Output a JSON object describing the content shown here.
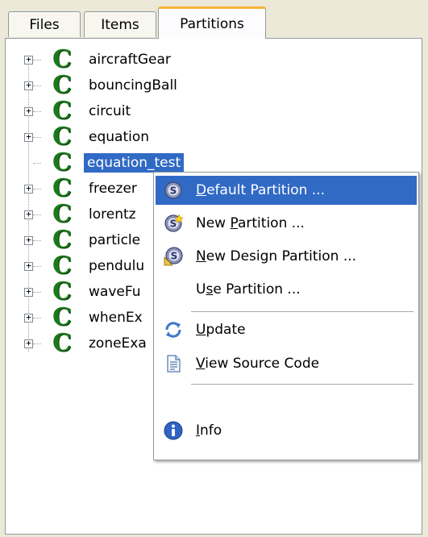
{
  "tabs": [
    {
      "label": "Files",
      "active": false
    },
    {
      "label": "Items",
      "active": false
    },
    {
      "label": "Partitions",
      "active": true
    }
  ],
  "tree": {
    "nodes": [
      {
        "label": "aircraftGear",
        "expandable": true,
        "selected": false
      },
      {
        "label": "bouncingBall",
        "expandable": true,
        "selected": false
      },
      {
        "label": "circuit",
        "expandable": true,
        "selected": false
      },
      {
        "label": "equation",
        "expandable": true,
        "selected": false
      },
      {
        "label": "equation_test",
        "expandable": false,
        "selected": true
      },
      {
        "label": "freezer",
        "expandable": true,
        "selected": false
      },
      {
        "label": "lorentz",
        "expandable": true,
        "selected": false
      },
      {
        "label": "particle",
        "expandable": true,
        "selected": false
      },
      {
        "label": "pendulu",
        "expandable": true,
        "selected": false
      },
      {
        "label": "waveFu",
        "expandable": true,
        "selected": false
      },
      {
        "label": "whenEx",
        "expandable": true,
        "selected": false
      },
      {
        "label": "zoneExa",
        "expandable": true,
        "selected": false
      }
    ],
    "node_icon": "class-c-icon"
  },
  "context_menu": {
    "items": [
      {
        "pre": "",
        "mnemonic": "D",
        "post": "efault Partition ...",
        "icon": "partition-icon",
        "highlighted": true
      },
      {
        "pre": "New ",
        "mnemonic": "P",
        "post": "artition ...",
        "icon": "new-partition-icon",
        "highlighted": false
      },
      {
        "pre": "",
        "mnemonic": "N",
        "post": "ew Design Partition ...",
        "icon": "design-partition-icon",
        "highlighted": false
      },
      {
        "pre": "U",
        "mnemonic": "s",
        "post": "e Partition ...",
        "icon": "",
        "highlighted": false
      },
      {
        "pre": "",
        "mnemonic": "U",
        "post": "pdate",
        "icon": "update-icon",
        "highlighted": false
      },
      {
        "pre": "",
        "mnemonic": "V",
        "post": "iew Source Code",
        "icon": "source-code-icon",
        "highlighted": false
      },
      {
        "pre": "",
        "mnemonic": "I",
        "post": "nfo",
        "icon": "info-icon",
        "highlighted": false
      }
    ]
  },
  "colors": {
    "selection": "#316ac5",
    "active_tab_accent": "#fbb339",
    "class_icon_green": "#1a7a1a"
  }
}
